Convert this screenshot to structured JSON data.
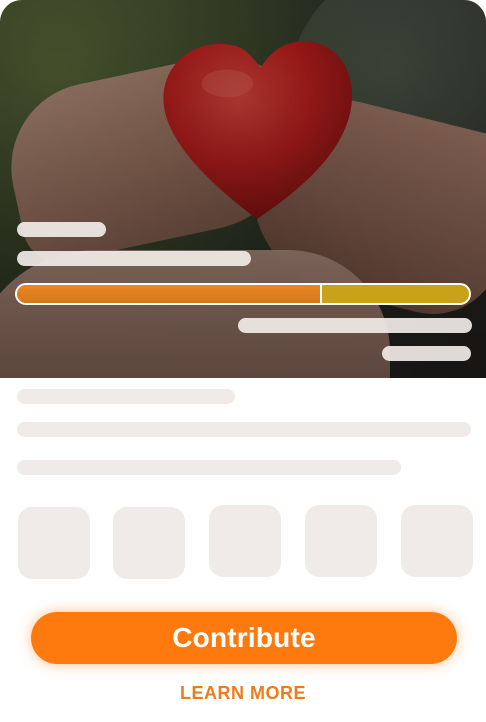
{
  "hero": {
    "image_description_icon": "heart-in-hands-image",
    "progress_fraction": 0.67
  },
  "actions": {
    "contribute_label": "Contribute",
    "learn_more_label": "LEARN MORE"
  },
  "colors": {
    "accent": "#ff7a0e",
    "progress_primary": "#e0831d",
    "progress_secondary": "#c9a21a",
    "skeleton": "#f0ebe8"
  }
}
